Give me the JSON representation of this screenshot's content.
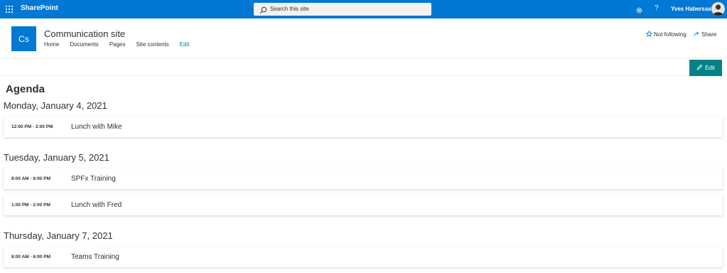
{
  "suite_bar": {
    "app_name": "SharePoint",
    "search_placeholder": "Search this site",
    "help_label": "?",
    "user_name": "Yves Habersaat"
  },
  "site": {
    "logo_initials": "Cs",
    "title": "Communication site",
    "nav": [
      "Home",
      "Documents",
      "Pages",
      "Site contents",
      "Edit"
    ],
    "follow_label": "Not following",
    "share_label": "Share"
  },
  "command_bar": {
    "edit_label": "Edit"
  },
  "agenda": {
    "title": "Agenda",
    "days": [
      {
        "label": "Monday, January 4, 2021",
        "events": [
          {
            "time": "12:00 PM - 2:00 PM",
            "title": "Lunch with Mike"
          }
        ]
      },
      {
        "label": "Tuesday, January 5, 2021",
        "events": [
          {
            "time": "8:00 AM - 6:00 PM",
            "title": "SPFx Training"
          },
          {
            "time": "1:00 PM - 2:00 PM",
            "title": "Lunch with Fred"
          }
        ]
      },
      {
        "label": "Thursday, January 7, 2021",
        "events": [
          {
            "time": "8:00 AM - 6:00 PM",
            "title": "Teams Training"
          }
        ]
      }
    ]
  },
  "colors": {
    "suite_bar": "#0078d4",
    "accent": "#038387",
    "text": "#323130"
  },
  "icons": [
    "waffle-icon",
    "search-icon",
    "gear-icon",
    "star-icon",
    "share-icon",
    "pencil-icon"
  ]
}
